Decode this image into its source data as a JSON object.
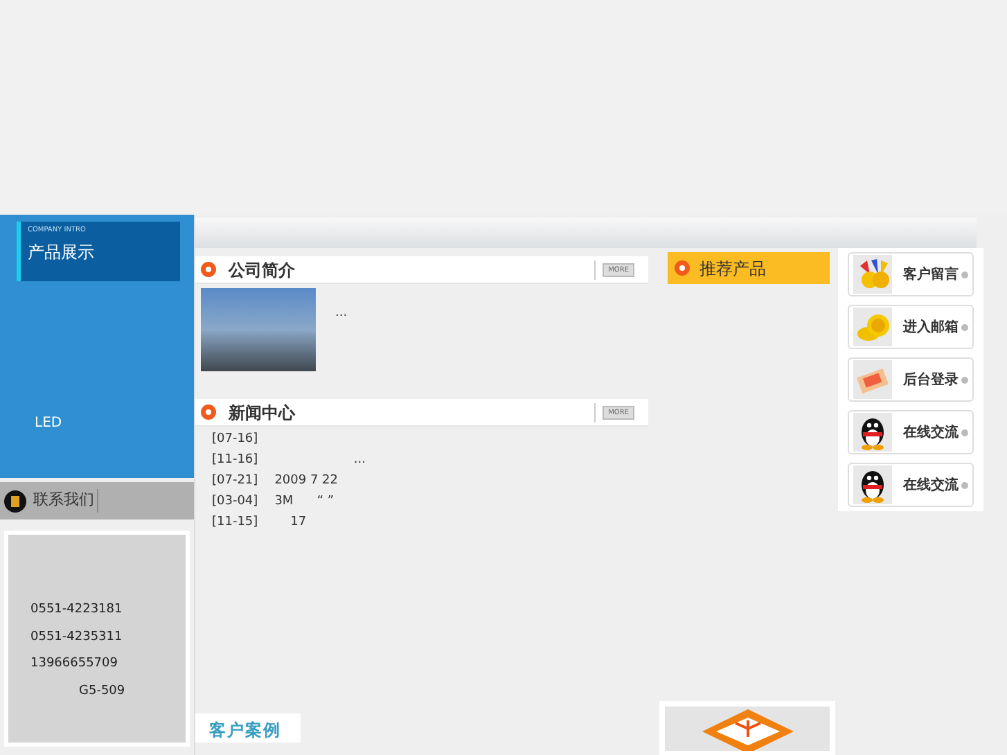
{
  "product_panel": {
    "subtitle": "COMPANY INTRO",
    "title": "产品展示",
    "caption": "LED"
  },
  "contact": {
    "title": "联系我们",
    "lines": [
      "0551-4223181",
      "0551-4235311",
      "13966655709",
      "G5-509"
    ]
  },
  "about": {
    "title": "公司简介",
    "more": "MORE",
    "text": "..."
  },
  "news": {
    "title": "新闻中心",
    "more": "MORE",
    "items": [
      {
        "date": "[07-16]"
      },
      {
        "date": "[11-16]",
        "text": "                    ..."
      },
      {
        "date": "[07-21]",
        "text": "2009 7 22"
      },
      {
        "date": "[03-04]",
        "text": "3M      “ ”"
      },
      {
        "date": "[11-15]",
        "text": "    17"
      }
    ]
  },
  "recommend": {
    "title": "推荐产品"
  },
  "links": [
    {
      "label": "客户留言",
      "kind": "hands"
    },
    {
      "label": "进入邮箱",
      "kind": "coins"
    },
    {
      "label": "后台登录",
      "kind": "ticket"
    },
    {
      "label": "在线交流",
      "kind": "penguin"
    },
    {
      "label": "在线交流",
      "kind": "penguin"
    }
  ],
  "cases": {
    "title": "客户案例"
  }
}
